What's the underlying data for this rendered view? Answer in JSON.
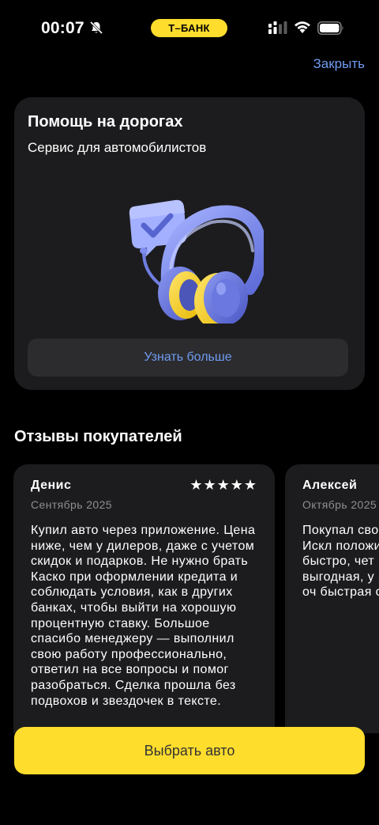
{
  "status_bar": {
    "time": "00:07",
    "bank_label": "Т–БАНК",
    "icons": [
      "bell-slash-icon",
      "cellular-signal-icon",
      "wifi-icon",
      "battery-icon"
    ]
  },
  "header": {
    "close_label": "Закрыть"
  },
  "promo": {
    "title": "Помощь на дорогах",
    "subtitle": "Сервис для автомобилистов",
    "illustration": "headphones-checkmark-icon",
    "button_label": "Узнать больше"
  },
  "reviews": {
    "heading": "Отзывы покупателей",
    "items": [
      {
        "name": "Денис",
        "date": "Сентябрь 2025",
        "stars": "★★★★★",
        "text": "Купил авто через приложение. Цена ниже, чем у дилеров, даже с учетом скидок и подарков. Не нужно брать Каско при оформлении кредита и соблюдать условия, как в других банках, чтобы выйти на хорошую процентную ставку. Большое спасибо менеджеру — выполнил свою работу профессионально, ответил на все вопросы и помог разобраться. Сделка прошла без подвохов и звездочек в тексте."
      },
      {
        "name": "Алексей",
        "date": "Октябрь 2025",
        "stars": "★★★★★",
        "text": "Покупал сво через серви Банке. Искл положитель спасибо мен быстро, чет цвете и ком была нужна выгодная, у вопросы. Не что было оч быстрая опл"
      }
    ]
  },
  "footer": {
    "choose_car_label": "Выбрать авто"
  },
  "colors": {
    "accent": "#ffdd2d",
    "link": "#6f9bf0",
    "card": "#1c1c1e",
    "background": "#000000"
  }
}
